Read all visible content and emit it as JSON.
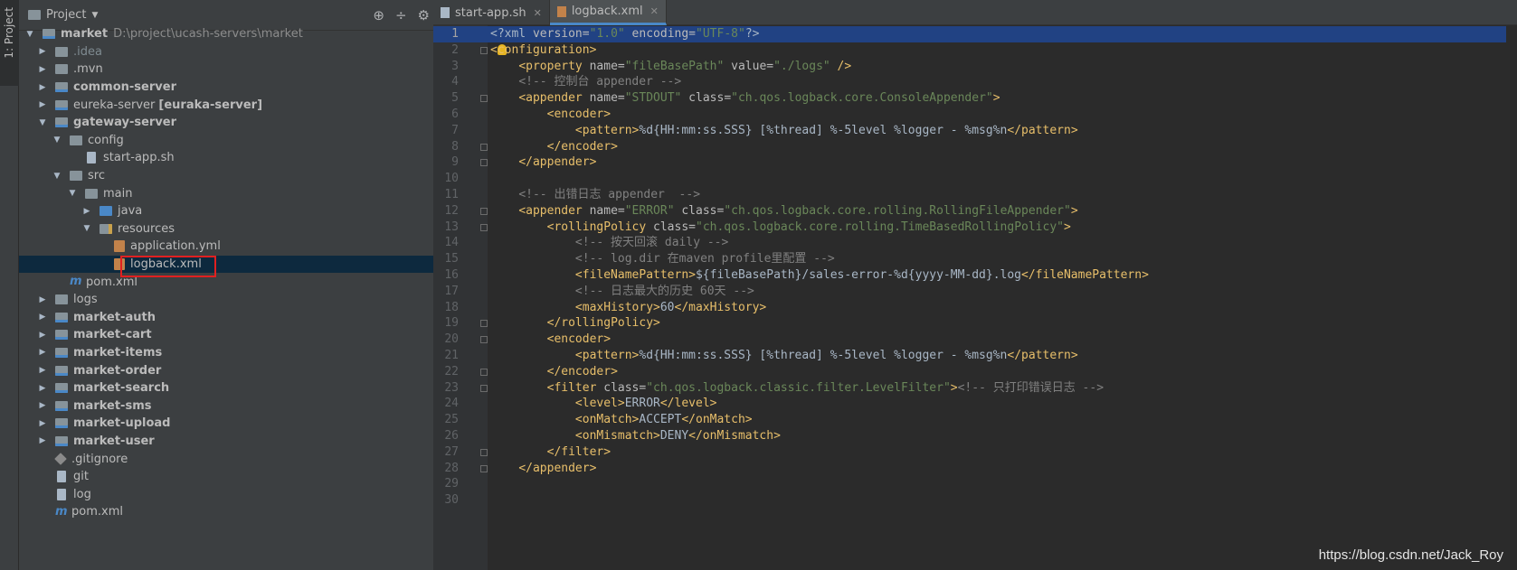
{
  "toolstrip": {
    "tab_label": "1: Project"
  },
  "project_panel": {
    "title": "Project",
    "tools": [
      "⊕",
      "÷",
      "⚙",
      "—"
    ],
    "tree": [
      {
        "indent": 0,
        "arrow": "▼",
        "icon": "module",
        "name": "market",
        "bold": true,
        "path": "D:\\project\\ucash-servers\\market"
      },
      {
        "indent": 1,
        "arrow": "▶",
        "icon": "folder",
        "name": ".idea",
        "style": "ignored"
      },
      {
        "indent": 1,
        "arrow": "▶",
        "icon": "folder",
        "name": ".mvn"
      },
      {
        "indent": 1,
        "arrow": "▶",
        "icon": "module",
        "name": "common-server",
        "bold": true
      },
      {
        "indent": 1,
        "arrow": "▶",
        "icon": "module",
        "name": "eureka-server",
        "suffix": "[euraka-server]"
      },
      {
        "indent": 1,
        "arrow": "▼",
        "icon": "module",
        "name": "gateway-server",
        "bold": true
      },
      {
        "indent": 2,
        "arrow": "▼",
        "icon": "folder",
        "name": "config"
      },
      {
        "indent": 3,
        "arrow": "",
        "icon": "file",
        "name": "start-app.sh"
      },
      {
        "indent": 2,
        "arrow": "▼",
        "icon": "folder",
        "name": "src"
      },
      {
        "indent": 3,
        "arrow": "▼",
        "icon": "folder",
        "name": "main"
      },
      {
        "indent": 4,
        "arrow": "▶",
        "icon": "src",
        "name": "java"
      },
      {
        "indent": 4,
        "arrow": "▼",
        "icon": "res",
        "name": "resources"
      },
      {
        "indent": 5,
        "arrow": "",
        "icon": "xml",
        "name": "application.yml"
      },
      {
        "indent": 5,
        "arrow": "",
        "icon": "xml",
        "name": "logback.xml",
        "selected": true
      },
      {
        "indent": 2,
        "arrow": "",
        "icon": "mvn",
        "name": "pom.xml"
      },
      {
        "indent": 1,
        "arrow": "▶",
        "icon": "folder",
        "name": "logs"
      },
      {
        "indent": 1,
        "arrow": "▶",
        "icon": "module",
        "name": "market-auth",
        "bold": true
      },
      {
        "indent": 1,
        "arrow": "▶",
        "icon": "module",
        "name": "market-cart",
        "bold": true
      },
      {
        "indent": 1,
        "arrow": "▶",
        "icon": "module",
        "name": "market-items",
        "bold": true
      },
      {
        "indent": 1,
        "arrow": "▶",
        "icon": "module",
        "name": "market-order",
        "bold": true
      },
      {
        "indent": 1,
        "arrow": "▶",
        "icon": "module",
        "name": "market-search",
        "bold": true
      },
      {
        "indent": 1,
        "arrow": "▶",
        "icon": "module",
        "name": "market-sms",
        "bold": true
      },
      {
        "indent": 1,
        "arrow": "▶",
        "icon": "module",
        "name": "market-upload",
        "bold": true
      },
      {
        "indent": 1,
        "arrow": "▶",
        "icon": "module",
        "name": "market-user",
        "bold": true
      },
      {
        "indent": 1,
        "arrow": "",
        "icon": "git",
        "name": ".gitignore"
      },
      {
        "indent": 1,
        "arrow": "",
        "icon": "file",
        "name": "git"
      },
      {
        "indent": 1,
        "arrow": "",
        "icon": "file",
        "name": "log"
      },
      {
        "indent": 1,
        "arrow": "",
        "icon": "mvn",
        "name": "pom.xml"
      }
    ]
  },
  "editor": {
    "tabs": [
      {
        "label": "start-app.sh",
        "active": false
      },
      {
        "label": "logback.xml",
        "active": true
      }
    ],
    "lines": [
      [
        [
          "tx",
          "<?xml "
        ],
        [
          "an",
          "version="
        ],
        [
          "av",
          "\"1.0\""
        ],
        [
          "an",
          " encoding="
        ],
        [
          "av",
          "\"UTF-8\""
        ],
        [
          "tx",
          "?>"
        ]
      ],
      [
        [
          "tg",
          "<configuration>"
        ]
      ],
      [
        [
          "tx",
          "    "
        ],
        [
          "tg",
          "<property "
        ],
        [
          "an",
          "name="
        ],
        [
          "av",
          "\"fileBasePath\""
        ],
        [
          "an",
          " value="
        ],
        [
          "av",
          "\"./logs\""
        ],
        [
          "tg",
          " />"
        ]
      ],
      [
        [
          "tx",
          "    "
        ],
        [
          "cm",
          "<!-- 控制台 appender -->"
        ]
      ],
      [
        [
          "tx",
          "    "
        ],
        [
          "tg",
          "<appender "
        ],
        [
          "an",
          "name="
        ],
        [
          "av",
          "\"STDOUT\""
        ],
        [
          "an",
          " class="
        ],
        [
          "av",
          "\"ch.qos.logback.core.ConsoleAppender\""
        ],
        [
          "tg",
          ">"
        ]
      ],
      [
        [
          "tx",
          "        "
        ],
        [
          "tg",
          "<encoder>"
        ]
      ],
      [
        [
          "tx",
          "            "
        ],
        [
          "tg",
          "<pattern>"
        ],
        [
          "tx",
          "%d{HH:mm:ss.SSS} [%thread] %-5level %logger - %msg%n"
        ],
        [
          "tg",
          "</pattern>"
        ]
      ],
      [
        [
          "tx",
          "        "
        ],
        [
          "tg",
          "</encoder>"
        ]
      ],
      [
        [
          "tx",
          "    "
        ],
        [
          "tg",
          "</appender>"
        ]
      ],
      [],
      [
        [
          "tx",
          "    "
        ],
        [
          "cm",
          "<!-- 出错日志 appender  -->"
        ]
      ],
      [
        [
          "tx",
          "    "
        ],
        [
          "tg",
          "<appender "
        ],
        [
          "an",
          "name="
        ],
        [
          "av",
          "\"ERROR\""
        ],
        [
          "an",
          " class="
        ],
        [
          "av",
          "\"ch.qos.logback.core.rolling.RollingFileAppender\""
        ],
        [
          "tg",
          ">"
        ]
      ],
      [
        [
          "tx",
          "        "
        ],
        [
          "tg",
          "<rollingPolicy "
        ],
        [
          "an",
          "class="
        ],
        [
          "av",
          "\"ch.qos.logback.core.rolling.TimeBasedRollingPolicy\""
        ],
        [
          "tg",
          ">"
        ]
      ],
      [
        [
          "tx",
          "            "
        ],
        [
          "cm",
          "<!-- 按天回滚 daily -->"
        ]
      ],
      [
        [
          "tx",
          "            "
        ],
        [
          "cm",
          "<!-- log.dir 在maven profile里配置 -->"
        ]
      ],
      [
        [
          "tx",
          "            "
        ],
        [
          "tg",
          "<fileNamePattern>"
        ],
        [
          "tx",
          "${fileBasePath}/sales-error-%d{yyyy-MM-dd}.log"
        ],
        [
          "tg",
          "</fileNamePattern>"
        ]
      ],
      [
        [
          "tx",
          "            "
        ],
        [
          "cm",
          "<!-- 日志最大的历史 60天 -->"
        ]
      ],
      [
        [
          "tx",
          "            "
        ],
        [
          "tg",
          "<maxHistory>"
        ],
        [
          "tx",
          "60"
        ],
        [
          "tg",
          "</maxHistory>"
        ]
      ],
      [
        [
          "tx",
          "        "
        ],
        [
          "tg",
          "</rollingPolicy>"
        ]
      ],
      [
        [
          "tx",
          "        "
        ],
        [
          "tg",
          "<encoder>"
        ]
      ],
      [
        [
          "tx",
          "            "
        ],
        [
          "tg",
          "<pattern>"
        ],
        [
          "tx",
          "%d{HH:mm:ss.SSS} [%thread] %-5level %logger - %msg%n"
        ],
        [
          "tg",
          "</pattern>"
        ]
      ],
      [
        [
          "tx",
          "        "
        ],
        [
          "tg",
          "</encoder>"
        ]
      ],
      [
        [
          "tx",
          "        "
        ],
        [
          "tg",
          "<filter "
        ],
        [
          "an",
          "class="
        ],
        [
          "av",
          "\"ch.qos.logback.classic.filter.LevelFilter\""
        ],
        [
          "tg",
          ">"
        ],
        [
          "cm",
          "<!-- 只打印错误日志 -->"
        ]
      ],
      [
        [
          "tx",
          "            "
        ],
        [
          "tg",
          "<level>"
        ],
        [
          "tx",
          "ERROR"
        ],
        [
          "tg",
          "</level>"
        ]
      ],
      [
        [
          "tx",
          "            "
        ],
        [
          "tg",
          "<onMatch>"
        ],
        [
          "tx",
          "ACCEPT"
        ],
        [
          "tg",
          "</onMatch>"
        ]
      ],
      [
        [
          "tx",
          "            "
        ],
        [
          "tg",
          "<onMismatch>"
        ],
        [
          "tx",
          "DENY"
        ],
        [
          "tg",
          "</onMismatch>"
        ]
      ],
      [
        [
          "tx",
          "        "
        ],
        [
          "tg",
          "</filter>"
        ]
      ],
      [
        [
          "tx",
          "    "
        ],
        [
          "tg",
          "</appender>"
        ]
      ],
      [],
      []
    ],
    "fold_lines": [
      2,
      5,
      8,
      9,
      12,
      13,
      19,
      20,
      22,
      23,
      27,
      28
    ]
  },
  "watermark": "https://blog.csdn.net/Jack_Roy"
}
